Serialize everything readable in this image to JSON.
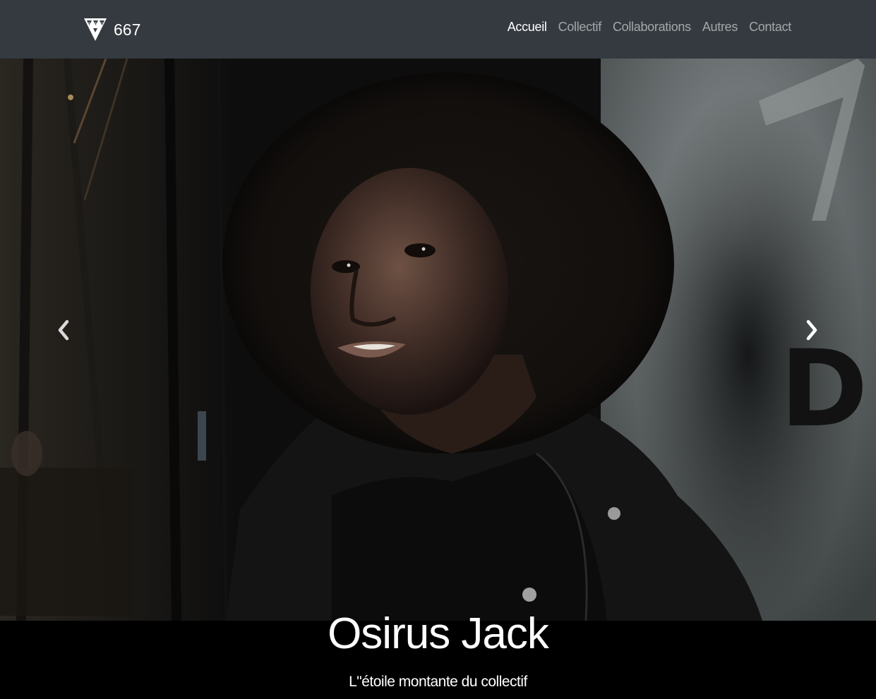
{
  "navbar": {
    "brand_text": "667",
    "brand_icon": "667-triangle-logo",
    "links": [
      {
        "label": "Accueil",
        "active": true
      },
      {
        "label": "Collectif",
        "active": false
      },
      {
        "label": "Collaborations",
        "active": false
      },
      {
        "label": "Autres",
        "active": false
      },
      {
        "label": "Contact",
        "active": false
      }
    ]
  },
  "carousel": {
    "prev_icon": "chevron-left-icon",
    "next_icon": "chevron-right-icon",
    "slide": {
      "title": "Osirus Jack",
      "subtitle": "L\"étoile montante du collectif"
    }
  },
  "colors": {
    "navbar_bg": "#343a40",
    "caption_bg": "#000000",
    "active_link": "#ffffff",
    "inactive_link": "#9a9da0"
  }
}
